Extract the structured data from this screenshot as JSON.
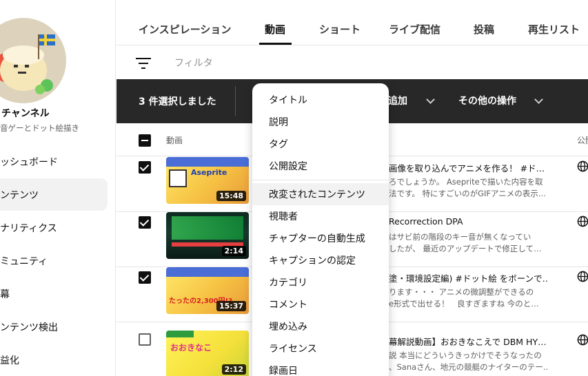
{
  "sidebar": {
    "channel_title": "チャンネル",
    "channel_subtitle": "音ゲーとドット絵描き",
    "items": [
      {
        "label": "ッシュボード"
      },
      {
        "label": "ンテンツ"
      },
      {
        "label": "ナリティクス"
      },
      {
        "label": "ミュニティ"
      },
      {
        "label": "幕"
      },
      {
        "label": "ンテンツ検出"
      },
      {
        "label": "益化"
      }
    ],
    "active_index": 1
  },
  "tabs": [
    {
      "label": "インスピレーション"
    },
    {
      "label": "動画"
    },
    {
      "label": "ショート"
    },
    {
      "label": "ライブ配信"
    },
    {
      "label": "投稿"
    },
    {
      "label": "再生リスト"
    }
  ],
  "filter": {
    "placeholder": "フィルタ",
    "icon": "filter-icon"
  },
  "selection_bar": {
    "count_label": "3 件選択しました",
    "add_label": "追加",
    "more_label": "その他の操作"
  },
  "table": {
    "col_video": "動画",
    "col_public": "公開"
  },
  "rows": [
    {
      "checked": true,
      "duration": "15:48",
      "thumb_text": "Aseprite",
      "title": "画像を取り込んでアニメを作る！ #ド…",
      "desc1": "ろでしょうか。 Asepriteで描いた内容を取",
      "desc2": "法です。 特にすごいのがGIFアニメの表示…"
    },
    {
      "checked": true,
      "duration": "2:14",
      "thumb_text": "",
      "title": "Recorrection DPA",
      "desc1": "はサビ前の階段のキー音が無くなってい",
      "desc2": "したが、 最近のアップデートで修正して…"
    },
    {
      "checked": true,
      "duration": "15:37",
      "thumb_text": "たったの2,300円!?",
      "title": "塗・環境設定編) #ドット絵 をボーンで…",
      "desc1": "ります・・・ アニメの微調整ができるの",
      "desc2": "e形式で出せる！　良すぎますね 今のと…"
    },
    {
      "checked": false,
      "duration": "2:12",
      "thumb_text": "おおきなこ",
      "title": "幕解説動画】おおきなこえで DBM HY…",
      "desc1": "説 本当にどういうきっかけでそうなったの",
      "desc2": "、Sanaさん、地元の競艇のナイターのテー…"
    }
  ],
  "menu": {
    "items": [
      {
        "label": "タイトル"
      },
      {
        "label": "説明"
      },
      {
        "label": "タグ"
      },
      {
        "label": "公開設定"
      },
      {
        "label": "改変されたコンテンツ"
      },
      {
        "label": "視聴者"
      },
      {
        "label": "チャプターの自動生成"
      },
      {
        "label": "キャプションの認定"
      },
      {
        "label": "カテゴリ"
      },
      {
        "label": "コメント"
      },
      {
        "label": "埋め込み"
      },
      {
        "label": "ライセンス"
      },
      {
        "label": "録画日"
      }
    ],
    "hover_index": 4
  },
  "colors": {
    "selection_bar": "#282828",
    "accent": "#0f0f0f",
    "muted": "#606060"
  }
}
